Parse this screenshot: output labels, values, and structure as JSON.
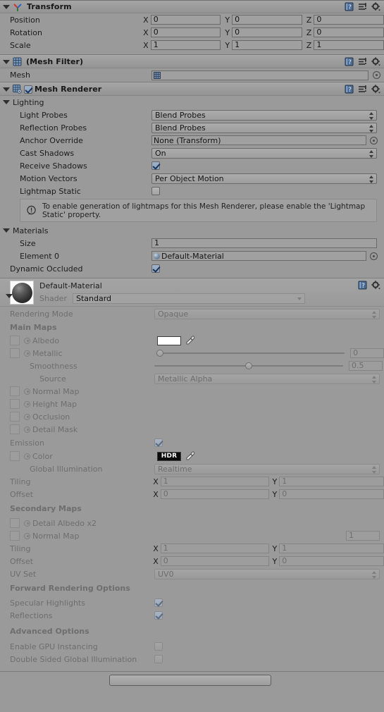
{
  "components": [
    {
      "id": "transform",
      "title": "Transform",
      "icon": "transform-gizmo-icon",
      "expanded": true,
      "header_icons": [
        "help-book-icon",
        "preset-icon",
        "gear-icon"
      ],
      "rows": [
        {
          "label": "Position",
          "x": "0",
          "y": "0",
          "z": "0"
        },
        {
          "label": "Rotation",
          "x": "0",
          "y": "0",
          "z": "0"
        },
        {
          "label": "Scale",
          "x": "1",
          "y": "1",
          "z": "1"
        }
      ],
      "axis_labels": {
        "x": "X",
        "y": "Y",
        "z": "Z"
      }
    },
    {
      "id": "mesh-filter",
      "title": "(Mesh Filter)",
      "icon": "mesh-filter-icon",
      "expanded": true,
      "header_icons": [
        "help-book-icon",
        "preset-icon",
        "gear-icon"
      ],
      "mesh_label": "Mesh",
      "mesh_value": ""
    },
    {
      "id": "mesh-renderer",
      "title": "Mesh Renderer",
      "icon": "mesh-renderer-icon",
      "enabled": true,
      "expanded": true,
      "header_icons": [
        "help-book-icon",
        "preset-icon",
        "gear-icon"
      ]
    }
  ],
  "lighting": {
    "section_label": "Lighting",
    "light_probes": {
      "label": "Light Probes",
      "value": "Blend Probes"
    },
    "reflection_probes": {
      "label": "Reflection Probes",
      "value": "Blend Probes"
    },
    "anchor_override": {
      "label": "Anchor Override",
      "value": "None (Transform)"
    },
    "cast_shadows": {
      "label": "Cast Shadows",
      "value": "On"
    },
    "receive_shadows": {
      "label": "Receive Shadows",
      "checked": true
    },
    "motion_vectors": {
      "label": "Motion Vectors",
      "value": "Per Object Motion"
    },
    "lightmap_static": {
      "label": "Lightmap Static",
      "checked": false
    },
    "help_text": "To enable generation of lightmaps for this Mesh Renderer, please enable the 'Lightmap Static' property."
  },
  "materials": {
    "section_label": "Materials",
    "size": {
      "label": "Size",
      "value": "1"
    },
    "element0": {
      "label": "Element 0",
      "value": "Default-Material"
    },
    "dynamic_occluded": {
      "label": "Dynamic Occluded",
      "checked": true
    }
  },
  "material_inspector": {
    "name": "Default-Material",
    "shader_label": "Shader",
    "shader_value": "Standard",
    "header_icons": [
      "help-book-icon",
      "gear-icon"
    ],
    "rendering_mode": {
      "label": "Rendering Mode",
      "value": "Opaque"
    },
    "main_maps": {
      "header": "Main Maps",
      "albedo": {
        "label": "Albedo",
        "color": "#ffffff"
      },
      "metallic": {
        "label": "Metallic",
        "value": "0",
        "slider": 0
      },
      "smoothness": {
        "label": "Smoothness",
        "value": "0.5",
        "slider": 0.5
      },
      "source": {
        "label": "Source",
        "value": "Metallic Alpha"
      },
      "normal_map": {
        "label": "Normal Map"
      },
      "height_map": {
        "label": "Height Map"
      },
      "occlusion": {
        "label": "Occlusion"
      },
      "detail_mask": {
        "label": "Detail Mask"
      },
      "emission": {
        "label": "Emission",
        "checked": true
      },
      "emission_color": {
        "label": "Color",
        "swatch_text": "HDR",
        "color": "#0a0a0a"
      },
      "global_illumination": {
        "label": "Global Illumination",
        "value": "Realtime"
      },
      "tiling": {
        "label": "Tiling",
        "x": "1",
        "y": "1"
      },
      "offset": {
        "label": "Offset",
        "x": "0",
        "y": "0"
      }
    },
    "secondary_maps": {
      "header": "Secondary Maps",
      "detail_albedo": {
        "label": "Detail Albedo x2"
      },
      "normal_map": {
        "label": "Normal Map",
        "value": "1"
      },
      "tiling": {
        "label": "Tiling",
        "x": "1",
        "y": "1"
      },
      "offset": {
        "label": "Offset",
        "x": "0",
        "y": "0"
      },
      "uv_set": {
        "label": "UV Set",
        "value": "UV0"
      }
    },
    "forward_rendering": {
      "header": "Forward Rendering Options",
      "specular_highlights": {
        "label": "Specular Highlights",
        "checked": true
      },
      "reflections": {
        "label": "Reflections",
        "checked": true
      }
    },
    "advanced": {
      "header": "Advanced Options",
      "gpu_instancing": {
        "label": "Enable GPU Instancing",
        "checked": false
      },
      "double_sided_gi": {
        "label": "Double Sided Global Illumination",
        "checked": false
      }
    }
  },
  "axis": {
    "x": "X",
    "y": "Y",
    "z": "Z"
  },
  "colors": {
    "panel_bg": "#9a9a9a",
    "header_bg": "#a0a0a0",
    "field_bg": "#a0a0a0",
    "border": "#6a6a6a",
    "text": "#1c1c1c",
    "disabled_text": "#6e6e6e",
    "checkbox_on": "#8fa4bd"
  }
}
